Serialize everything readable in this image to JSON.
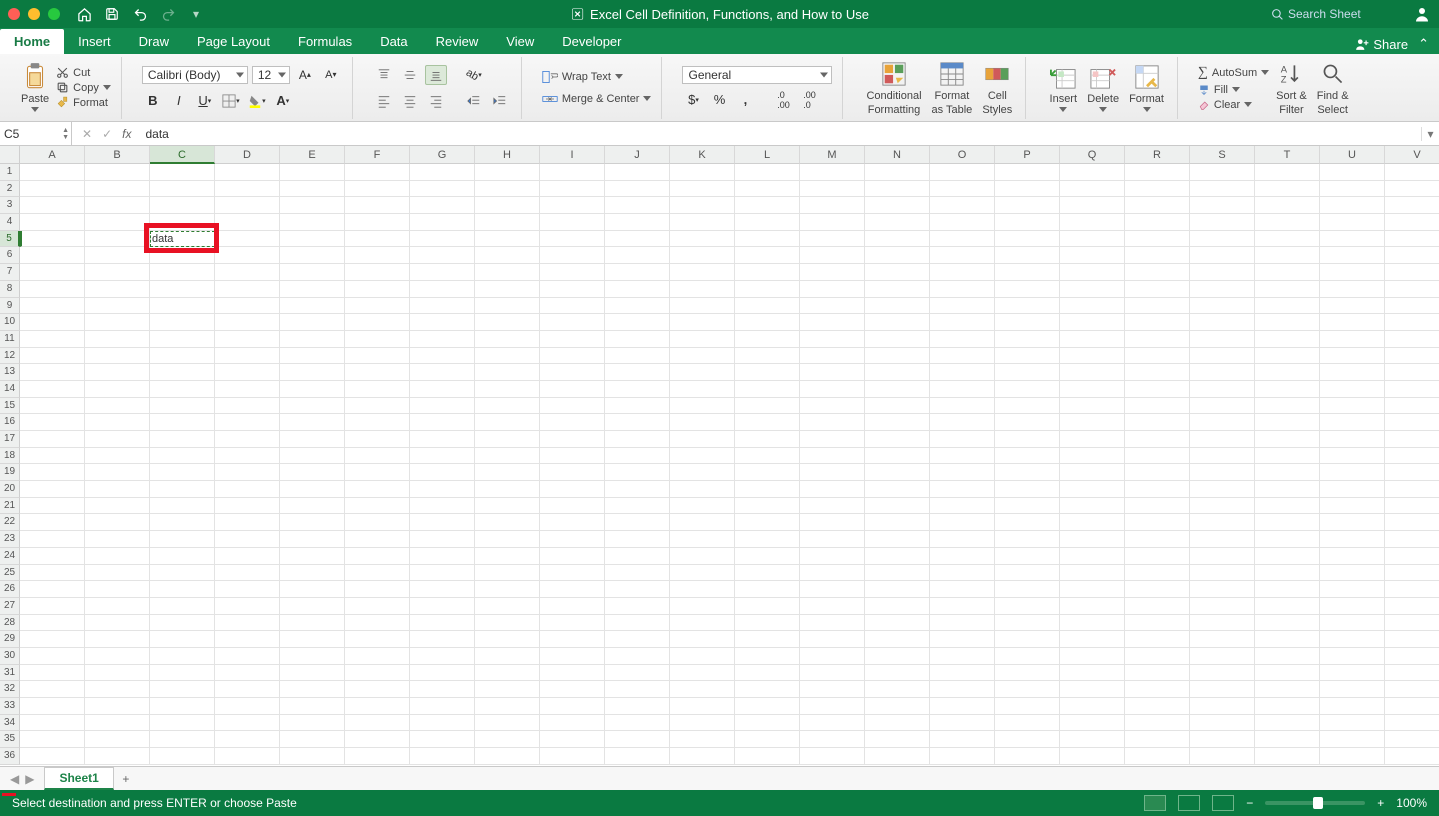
{
  "titlebar": {
    "title": "Excel Cell Definition, Functions, and How to Use",
    "search_placeholder": "Search Sheet"
  },
  "tabs": {
    "items": [
      "Home",
      "Insert",
      "Draw",
      "Page Layout",
      "Formulas",
      "Data",
      "Review",
      "View",
      "Developer"
    ],
    "share": "Share"
  },
  "ribbon": {
    "paste": "Paste",
    "cut": "Cut",
    "copy": "Copy",
    "format_painter": "Format",
    "font_name": "Calibri (Body)",
    "font_size": "12",
    "wrap": "Wrap Text",
    "merge": "Merge & Center",
    "number_format": "General",
    "cond_fmt": "Conditional",
    "cond_fmt2": "Formatting",
    "fmt_table": "Format",
    "fmt_table2": "as Table",
    "cell_styles": "Cell",
    "cell_styles2": "Styles",
    "insert": "Insert",
    "delete": "Delete",
    "format": "Format",
    "autosum": "AutoSum",
    "fill": "Fill",
    "clear": "Clear",
    "sort": "Sort &",
    "sort2": "Filter",
    "find": "Find &",
    "find2": "Select"
  },
  "fbar": {
    "name": "C5",
    "fx": "data"
  },
  "grid": {
    "cols": [
      "A",
      "B",
      "C",
      "D",
      "E",
      "F",
      "G",
      "H",
      "I",
      "J",
      "K",
      "L",
      "M",
      "N",
      "O",
      "P",
      "Q",
      "R",
      "S",
      "T",
      "U",
      "V"
    ],
    "rows": 36,
    "selected_col_index": 2,
    "selected_row_index": 4,
    "cell_value": "data"
  },
  "sheetbar": {
    "sheet": "Sheet1"
  },
  "status": {
    "msg": "Select destination and press ENTER or choose Paste",
    "zoom": "100%"
  }
}
